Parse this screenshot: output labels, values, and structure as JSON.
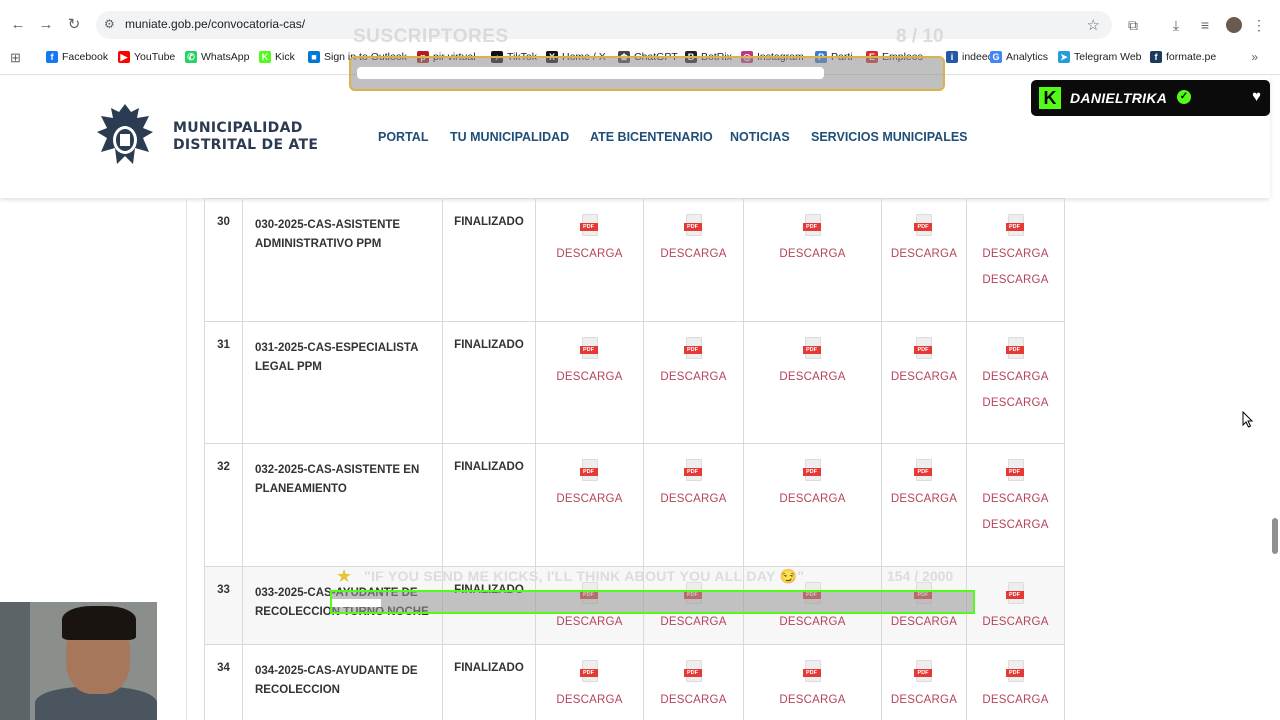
{
  "browser": {
    "url": "muniate.gob.pe/convocatoria-cas/",
    "nav": {
      "back": "←",
      "forward": "→",
      "reload": "↻"
    },
    "bookmarks": [
      {
        "label": "Facebook",
        "color": "#1877f2",
        "glyph": "f"
      },
      {
        "label": "YouTube",
        "color": "#ff0000",
        "glyph": "▶"
      },
      {
        "label": "WhatsApp",
        "color": "#25d366",
        "glyph": "✆"
      },
      {
        "label": "Kick",
        "color": "#53fc18",
        "glyph": "K"
      },
      {
        "label": "Sign in to Outlook",
        "color": "#0078d4",
        "glyph": "■"
      },
      {
        "label": "pir virtual",
        "color": "#b71c1c",
        "glyph": "p"
      },
      {
        "label": "TikTok",
        "color": "#111111",
        "glyph": "♪"
      },
      {
        "label": "Home / X",
        "color": "#111111",
        "glyph": "X"
      },
      {
        "label": "ChatGPT",
        "color": "#444444",
        "glyph": "✿"
      },
      {
        "label": "BotRix",
        "color": "#222222",
        "glyph": "B"
      },
      {
        "label": "Instagram",
        "color": "#c13584",
        "glyph": "◎"
      },
      {
        "label": "Parti",
        "color": "#3a7bd5",
        "glyph": "P"
      },
      {
        "label": "Empleos",
        "color": "#d32f2f",
        "glyph": "E"
      },
      {
        "label": "indeed",
        "color": "#2557a7",
        "glyph": "i"
      },
      {
        "label": "Analytics",
        "color": "#4285f4",
        "glyph": "G"
      },
      {
        "label": "Telegram Web",
        "color": "#229ed9",
        "glyph": "➤"
      },
      {
        "label": "formate.pe",
        "color": "#1b3a5c",
        "glyph": "f"
      }
    ]
  },
  "site": {
    "logo_line1": "MUNICIPALIDAD",
    "logo_line2": "DISTRITAL DE ATE",
    "menu": [
      "PORTAL",
      "TU MUNICIPALIDAD",
      "ATE BICENTENARIO",
      "NOTICIAS",
      "SERVICIOS MUNICIPALES"
    ]
  },
  "table": {
    "rows": [
      {
        "num": "30",
        "name_l1": "030-2025-CAS-ASISTENTE",
        "name_l2": "ADMINISTRATIVO PPM",
        "status": "FINALIZADO",
        "extra": "DESCARGA"
      },
      {
        "num": "31",
        "name_l1": "031-2025-CAS-ESPECIALISTA",
        "name_l2": "LEGAL PPM",
        "status": "FINALIZADO",
        "extra": "DESCARGA"
      },
      {
        "num": "32",
        "name_l1": "032-2025-CAS-ASISTENTE EN",
        "name_l2": "PLANEAMIENTO",
        "status": "FINALIZADO",
        "extra": "DESCARGA"
      },
      {
        "num": "33",
        "name_l1": "033-2025-CAS-AYUDANTE DE",
        "name_l2": "RECOLECCION TURNO NOCHE",
        "status": "FINALIZADO",
        "extra": ""
      },
      {
        "num": "34",
        "name_l1": "034-2025-CAS-AYUDANTE DE",
        "name_l2": "RECOLECCION",
        "status": "FINALIZADO",
        "extra": ""
      }
    ],
    "download_label": "DESCARGA",
    "pdf_tag": "PDF"
  },
  "overlays": {
    "subs_label": "SUSCRIPTORES",
    "subs_count": "8 / 10",
    "subs_progress": 0.8,
    "kick_name": "DANIELTRIKA",
    "goal_text": "\"IF YOU SEND ME KICKS, I'LL THINK ABOUT YOU ALL DAY 😏\"",
    "goal_count": "154 / 2000",
    "goal_progress": 0.077
  }
}
